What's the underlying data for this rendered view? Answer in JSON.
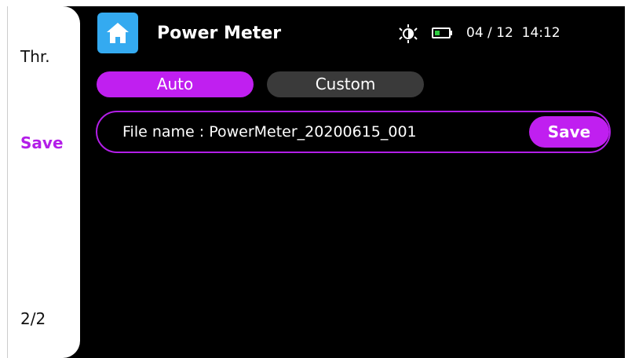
{
  "header": {
    "title": "Power Meter",
    "date": "04 / 12",
    "time": "14:12",
    "icons": [
      "home-icon",
      "brightness-icon",
      "battery-icon"
    ]
  },
  "sidebar": {
    "items": [
      {
        "label": "Thr."
      },
      {
        "label": "Save",
        "active": true
      }
    ],
    "page_indicator": "2/2"
  },
  "modes": {
    "auto_label": "Auto",
    "custom_label": "Custom",
    "selected": "Auto"
  },
  "file": {
    "label": "File name : PowerMeter_20200615_001",
    "save_label": "Save"
  },
  "colors": {
    "accent": "#c01ff0",
    "home_button": "#34aaf0",
    "background": "#000000",
    "inactive_button": "#3a3a3a"
  }
}
